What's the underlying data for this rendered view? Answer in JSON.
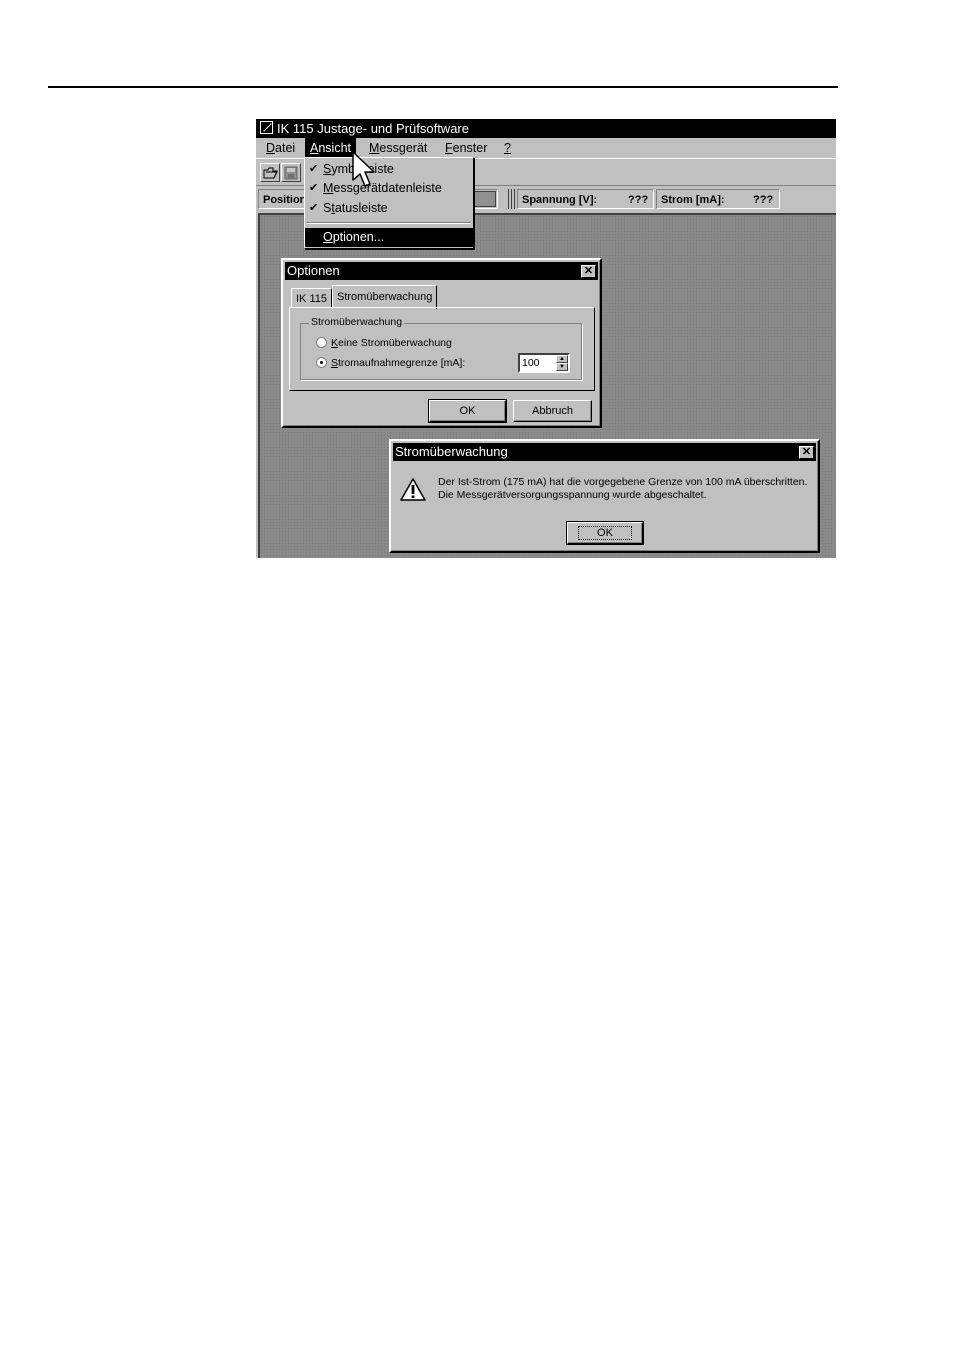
{
  "app": {
    "title": "IK 115 Justage- und Prüfsoftware",
    "menu": {
      "datei": {
        "pre": "",
        "ul": "D",
        "post": "atei"
      },
      "ansicht": {
        "pre": "",
        "ul": "A",
        "post": "nsicht"
      },
      "messgeraet": {
        "pre": "",
        "ul": "M",
        "post": "essgerät"
      },
      "fenster": {
        "pre": "",
        "ul": "F",
        "post": "enster"
      },
      "help": {
        "pre": "",
        "ul": "?",
        "post": ""
      }
    },
    "toolbar": {
      "open_icon": "open-folder-icon",
      "save_icon": "save-disk-icon"
    },
    "status": {
      "position_label": "Position",
      "voltage_label": "Spannung [V]:",
      "voltage_value": "???",
      "current_label": "Strom [mA]:",
      "current_value": "???"
    }
  },
  "view_menu": {
    "items": [
      {
        "pre": "",
        "ul": "S",
        "post": "ymbolleiste",
        "checked": true
      },
      {
        "pre": "",
        "ul": "M",
        "post": "essgerätdatenleiste",
        "checked": true
      },
      {
        "pre": "S",
        "ul": "t",
        "post": "atusleiste",
        "checked": true
      },
      {
        "pre": "",
        "ul": "O",
        "post": "ptionen...",
        "checked": false,
        "selected": true
      }
    ],
    "check_glyph": "✔"
  },
  "options_dialog": {
    "title": "Optionen",
    "tabs": [
      "IK 115",
      "Stromüberwachung"
    ],
    "group_label": "Stromüberwachung",
    "radio_none": {
      "pre": "",
      "ul": "K",
      "post": "eine Stromüberwachung",
      "checked": false
    },
    "radio_limit": {
      "pre": "",
      "ul": "S",
      "post": "tromaufnahmegrenze [mA]:",
      "checked": true
    },
    "limit_value": "100",
    "ok_label": "OK",
    "cancel_label": "Abbruch"
  },
  "alert_dialog": {
    "title": "Stromüberwachung",
    "icon": "warning-icon",
    "line1": "Der Ist-Strom (175 mA) hat die vorgegebene Grenze von 100 mA überschritten.",
    "line2": "Die Messgerätversorgungsspannung wurde abgeschaltet.",
    "ok_label": "OK"
  }
}
